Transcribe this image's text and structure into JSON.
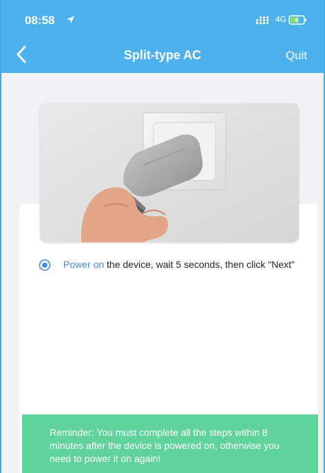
{
  "status_bar": {
    "time": "08:58",
    "network": "4G",
    "location_icon": "location-arrow-icon",
    "signal_icon": "signal-icon",
    "battery_icon": "battery-charging-icon"
  },
  "header": {
    "title": "Split-type AC",
    "back_icon": "chevron-left-icon",
    "quit_label": "Quit"
  },
  "illustration": {
    "icon": "plug-in-socket-icon"
  },
  "step": {
    "highlight": "Power on",
    "text": " the device, wait 5 seconds, then click \"Next\"",
    "selected": true
  },
  "reminder": {
    "text": "Reminder: You must complete all the steps within 8 minutes after the device is powered on, otherwise you need  to power it on again!"
  },
  "colors": {
    "header_bg": "#4cb2ee",
    "accent": "#3c8ee0",
    "reminder_bg": "#60d39a"
  }
}
